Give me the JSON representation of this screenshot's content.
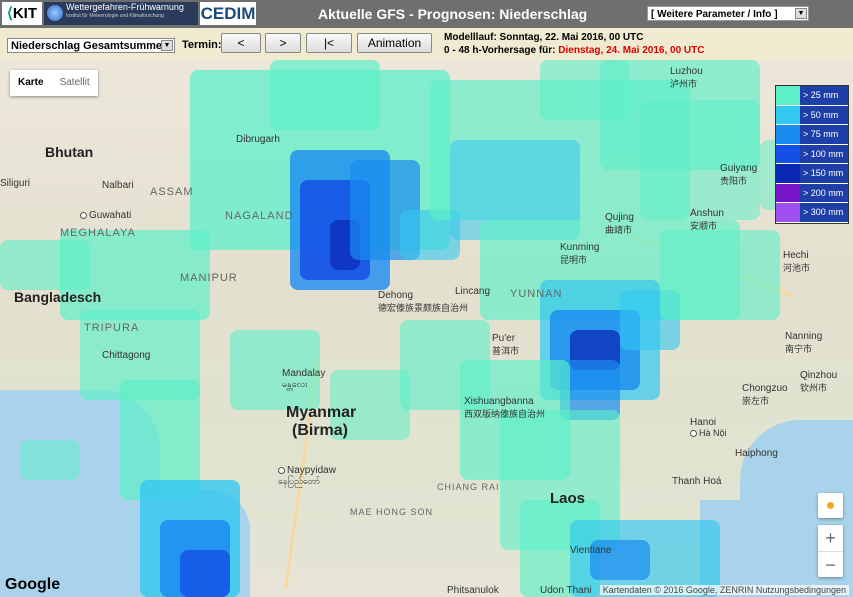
{
  "header": {
    "logo_kit": "KIT",
    "logo_wf_title": "Wettergefahren-Frühwarnung",
    "logo_wf_subtitle": "Institut für Meteorologie und Klimaforschung",
    "logo_cedim": "CEDIM",
    "title": "Aktuelle GFS - Prognosen: Niederschlag",
    "param_select": "[ Weitere Parameter / Info ]"
  },
  "toolbar": {
    "product_select": "Niederschlag Gesamtsumme",
    "termin_label": "Termin:",
    "prev_label": "<",
    "next_label": ">",
    "first_label": "|<",
    "animation_label": "Animation",
    "model_run": "Modelllauf: Sonntag, 22. Mai 2016, 00 UTC",
    "forecast_prefix": "0 - 48 h-Vorhersage für: ",
    "forecast_date": "Dienstag, 24. Mai 2016, 00 UTC"
  },
  "map": {
    "maptype": [
      "Karte",
      "Satellit"
    ],
    "legend": [
      {
        "label": "> 25 mm",
        "color": "#5cf0c8"
      },
      {
        "label": "> 50 mm",
        "color": "#33c8f0"
      },
      {
        "label": "> 75 mm",
        "color": "#1a8cf0"
      },
      {
        "label": "> 100 mm",
        "color": "#1450e6"
      },
      {
        "label": "> 150 mm",
        "color": "#0a28b4"
      },
      {
        "label": "> 200 mm",
        "color": "#7a14c8"
      },
      {
        "label": "> 300 mm",
        "color": "#a050f0"
      }
    ],
    "countries": [
      "Bhutan",
      "Bangladesch",
      "Myanmar",
      "(Birma)",
      "Laos"
    ],
    "cities": [
      {
        "name": "Guwahati",
        "cn": ""
      },
      {
        "name": "Chittagong",
        "cn": ""
      },
      {
        "name": "Mandalay",
        "cn": "မန္တလေး"
      },
      {
        "name": "Naypyidaw",
        "cn": "နေပြည်တော်"
      },
      {
        "name": "Kunming",
        "cn": "昆明市"
      },
      {
        "name": "Nanning",
        "cn": "南宁市"
      },
      {
        "name": "Hanoi",
        "cn": "Hà Nội"
      },
      {
        "name": "Haiphong",
        "cn": ""
      },
      {
        "name": "Vientiane",
        "cn": ""
      },
      {
        "name": "Luzhou",
        "cn": "泸州市"
      },
      {
        "name": "Guiyang",
        "cn": "贵阳市"
      },
      {
        "name": "Anshun",
        "cn": "安顺市"
      },
      {
        "name": "Dehong",
        "cn": "德宏傣族景颇族自治州"
      },
      {
        "name": "Xishuangbanna",
        "cn": "西双版纳傣族自治州"
      },
      {
        "name": "Chongzuo",
        "cn": "崇左市"
      },
      {
        "name": "Qinzhou",
        "cn": "钦州市"
      },
      {
        "name": "Thanh Hoá",
        "cn": ""
      },
      {
        "name": "Dibrugarh",
        "cn": ""
      },
      {
        "name": "Nalbari",
        "cn": ""
      },
      {
        "name": "Siliguri",
        "cn": ""
      },
      {
        "name": "ASSAM",
        "cn": ""
      },
      {
        "name": "MANIPUR",
        "cn": ""
      },
      {
        "name": "MEGHALAYA",
        "cn": ""
      },
      {
        "name": "TRIPURA",
        "cn": ""
      },
      {
        "name": "NAGALAND",
        "cn": ""
      },
      {
        "name": "YUNNAN",
        "cn": ""
      },
      {
        "name": "CHIANG RAI",
        "cn": ""
      },
      {
        "name": "MAE HONG SON",
        "cn": ""
      },
      {
        "name": "Phitsanulok",
        "cn": ""
      },
      {
        "name": "Udon Thani",
        "cn": ""
      },
      {
        "name": "Lincang",
        "cn": ""
      },
      {
        "name": "Pu'er",
        "cn": "普洱市"
      },
      {
        "name": "Qujing",
        "cn": "曲靖市"
      },
      {
        "name": "Hechi",
        "cn": "河池市"
      }
    ],
    "google": "Google",
    "attribution": "Kartendaten © 2016 Google, ZENRIN   Nutzungsbedingungen",
    "zoom_in": "+",
    "zoom_out": "−"
  }
}
